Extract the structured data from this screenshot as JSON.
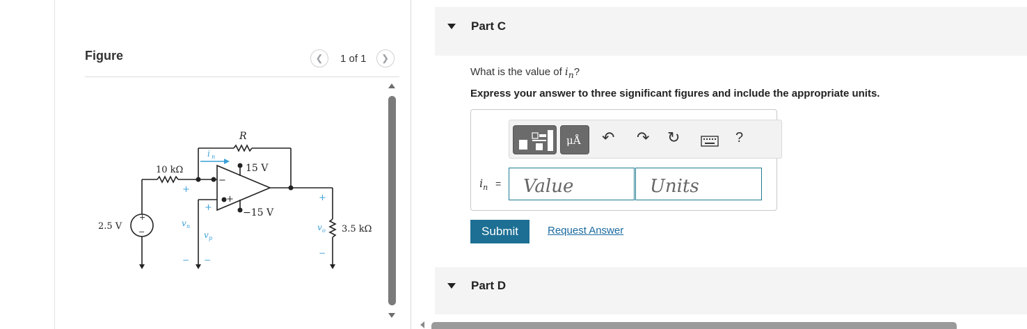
{
  "figure": {
    "title": "Figure",
    "pager_label": "1 of 1",
    "prev_icon": "chevron-left-icon",
    "next_icon": "chevron-right-icon",
    "circuit": {
      "resistor_top": "R",
      "current_label": "i",
      "current_sub": "n",
      "resistor_left": "10 kΩ",
      "supply_pos": "15 V",
      "supply_neg": "−15 V",
      "source": "2.5 V",
      "vn": "v",
      "vn_sub": "n",
      "vp": "v",
      "vp_sub": "p",
      "vo": "v",
      "vo_sub": "o",
      "load": "3.5 kΩ",
      "plus": "+",
      "minus": "−"
    }
  },
  "part_c": {
    "title": "Part C",
    "question_prefix": "What is the value of ",
    "question_var": "i",
    "question_sub": "n",
    "question_suffix": "?",
    "instruction": "Express your answer to three significant figures and include the appropriate units.",
    "answer_label": "i",
    "answer_label_sub": "n",
    "answer_eq": "=",
    "value_placeholder": "Value",
    "units_placeholder": "Units",
    "toolbar": {
      "units_btn_label": "μÅ",
      "undo_glyph": "↶",
      "redo_glyph": "↷",
      "reset_glyph": "↻",
      "help_glyph": "?"
    },
    "submit_label": "Submit",
    "request_label": "Request Answer"
  },
  "part_d": {
    "title": "Part D"
  },
  "colors": {
    "accent": "#1d6f94",
    "link": "#1a6aa0",
    "input_border": "#1f7a8f",
    "current_arrow": "#3aa0d8"
  }
}
